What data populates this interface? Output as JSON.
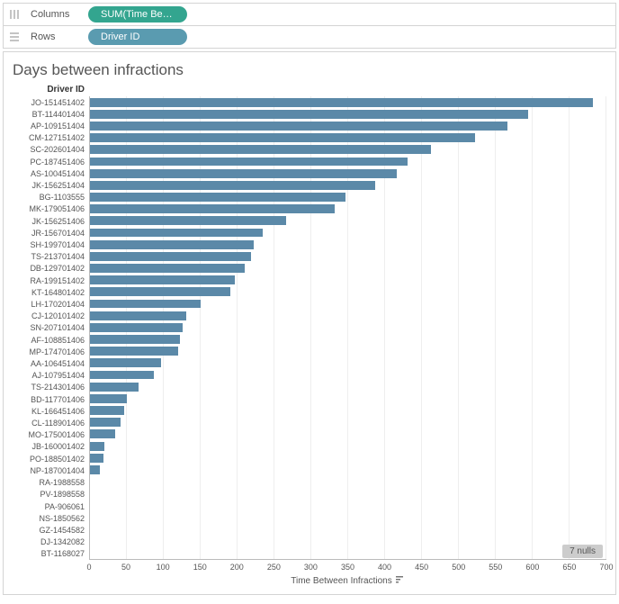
{
  "shelves": {
    "columns_label": "Columns",
    "rows_label": "Rows",
    "columns_pill": "SUM(Time Between I..",
    "rows_pill": "Driver ID"
  },
  "chart_data": {
    "type": "bar",
    "title": "Days between infractions",
    "y_axis_header": "Driver ID",
    "xlabel": "Time Between Infractions",
    "xlim": [
      0,
      700
    ],
    "xticks": [
      0,
      50,
      100,
      150,
      200,
      250,
      300,
      350,
      400,
      450,
      500,
      550,
      600,
      650,
      700
    ],
    "nulls_label": "7 nulls",
    "categories": [
      "JO-151451402",
      "BT-114401404",
      "AP-109151404",
      "CM-127151402",
      "SC-202601404",
      "PC-187451406",
      "AS-100451404",
      "JK-156251404",
      "BG-1103555",
      "MK-179051406",
      "JK-156251406",
      "JR-156701404",
      "SH-199701404",
      "TS-213701404",
      "DB-129701402",
      "RA-199151402",
      "KT-164801402",
      "LH-170201404",
      "CJ-120101402",
      "SN-207101404",
      "AF-108851406",
      "MP-174701406",
      "AA-106451404",
      "AJ-107951404",
      "TS-214301406",
      "BD-117701406",
      "KL-166451406",
      "CL-118901406",
      "MO-175001406",
      "JB-160001402",
      "PO-188501402",
      "NP-187001404",
      "RA-1988558",
      "PV-1898558",
      "PA-906061",
      "NS-1850562",
      "GZ-1454582",
      "DJ-1342082",
      "BT-1168027"
    ],
    "values": [
      682,
      594,
      566,
      522,
      462,
      430,
      416,
      387,
      346,
      332,
      266,
      234,
      222,
      218,
      210,
      196,
      190,
      150,
      130,
      126,
      122,
      120,
      96,
      86,
      66,
      50,
      46,
      42,
      34,
      20,
      18,
      14,
      0,
      0,
      0,
      0,
      0,
      0,
      0
    ]
  }
}
